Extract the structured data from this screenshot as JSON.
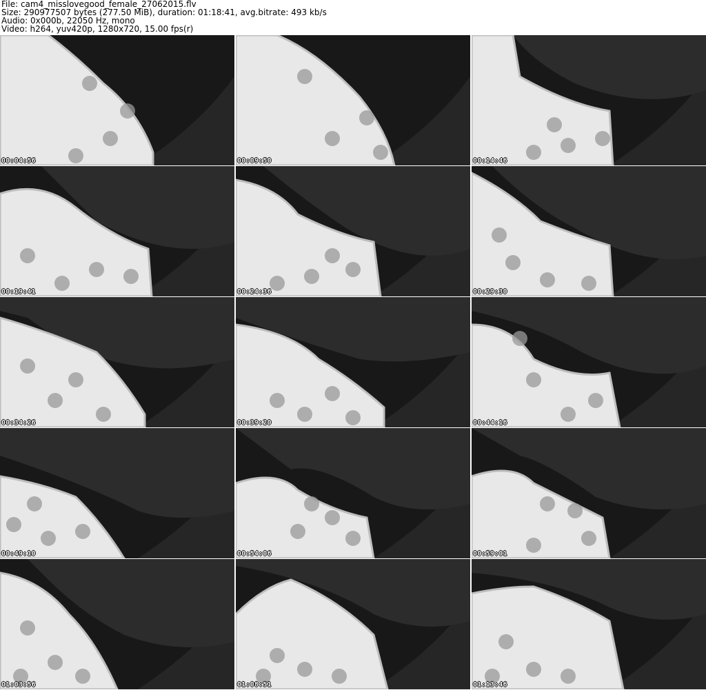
{
  "header": {
    "file_line": "File: cam4_misslovegood_female_27062015.flv",
    "size_line": "Size: 290977507 bytes (277.50 MiB), duration: 01:18:41, avg.bitrate: 493 kb/s",
    "audio_line": "Audio: 0x000b, 22050 Hz, mono",
    "video_line": "Video: h264, yuv420p, 1280x720, 15.00 fps(r)"
  },
  "thumbnails": [
    {
      "timestamp": "00:04:56"
    },
    {
      "timestamp": "00:09:50"
    },
    {
      "timestamp": "00:14:46"
    },
    {
      "timestamp": "00:19:41"
    },
    {
      "timestamp": "00:24:36"
    },
    {
      "timestamp": "00:29:30"
    },
    {
      "timestamp": "00:34:26"
    },
    {
      "timestamp": "00:39:20"
    },
    {
      "timestamp": "00:44:16"
    },
    {
      "timestamp": "00:49:10"
    },
    {
      "timestamp": "00:54:06"
    },
    {
      "timestamp": "00:59:01"
    },
    {
      "timestamp": "01:03:56"
    },
    {
      "timestamp": "01:08:51"
    },
    {
      "timestamp": "01:13:46"
    }
  ]
}
